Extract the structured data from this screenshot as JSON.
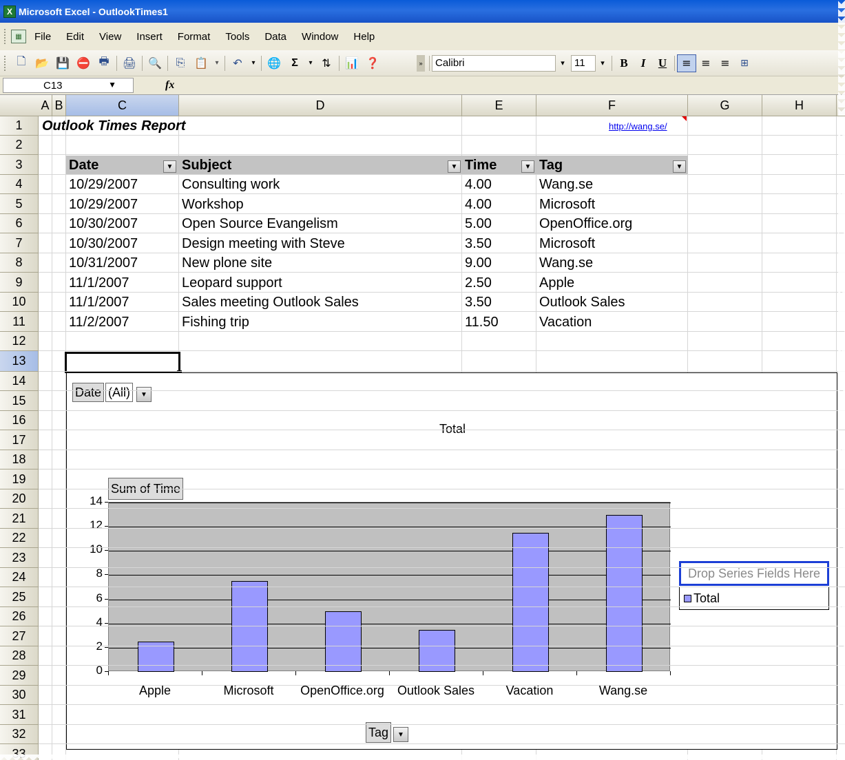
{
  "window": {
    "title": "Microsoft Excel - OutlookTimes1",
    "app_icon": "excel-icon"
  },
  "menu": [
    "File",
    "Edit",
    "View",
    "Insert",
    "Format",
    "Tools",
    "Data",
    "Window",
    "Help"
  ],
  "toolbar": {
    "font_name": "Calibri",
    "font_size": "11",
    "bold_label": "B",
    "italic_label": "I",
    "underline_label": "U",
    "sigma_label": "Σ"
  },
  "formula_bar": {
    "cell_ref": "C13",
    "fx_label": "fx",
    "content": ""
  },
  "columns": [
    "A",
    "B",
    "C",
    "D",
    "E",
    "F",
    "G",
    "H"
  ],
  "rows": [
    "1",
    "2",
    "3",
    "4",
    "5",
    "6",
    "7",
    "8",
    "9",
    "10",
    "11",
    "12",
    "13",
    "14",
    "15",
    "16",
    "17",
    "18",
    "19",
    "20",
    "21",
    "22",
    "23",
    "24",
    "25",
    "26",
    "27",
    "28",
    "29",
    "30",
    "31",
    "32",
    "33"
  ],
  "sheet": {
    "title": "Outlook Times Report",
    "link": "http://wang.se/",
    "headers": [
      "Date",
      "Subject",
      "Time",
      "Tag"
    ],
    "records": [
      {
        "date": "10/29/2007",
        "subject": "Consulting work",
        "time": "4.00",
        "tag": "Wang.se"
      },
      {
        "date": "10/29/2007",
        "subject": "Workshop",
        "time": "4.00",
        "tag": "Microsoft"
      },
      {
        "date": "10/30/2007",
        "subject": "Open Source Evangelism",
        "time": "5.00",
        "tag": "OpenOffice.org"
      },
      {
        "date": "10/30/2007",
        "subject": "Design meeting with Steve",
        "time": "3.50",
        "tag": "Microsoft"
      },
      {
        "date": "10/31/2007",
        "subject": "New plone site",
        "time": "9.00",
        "tag": "Wang.se"
      },
      {
        "date": "11/1/2007",
        "subject": "Leopard support",
        "time": "2.50",
        "tag": "Apple"
      },
      {
        "date": "11/1/2007",
        "subject": "Sales meeting Outlook Sales",
        "time": "3.50",
        "tag": "Outlook Sales"
      },
      {
        "date": "11/2/2007",
        "subject": "Fishing trip",
        "time": "11.50",
        "tag": "Vacation"
      }
    ]
  },
  "pivot": {
    "page_field": "Date",
    "page_value": "(All)",
    "data_field": "Sum of Time",
    "category_field": "Tag",
    "drop_series": "Drop Series Fields Here"
  },
  "chart_data": {
    "type": "bar",
    "title": "Total",
    "categories": [
      "Apple",
      "Microsoft",
      "OpenOffice.org",
      "Outlook Sales",
      "Vacation",
      "Wang.se"
    ],
    "series": [
      {
        "name": "Total",
        "values": [
          2.5,
          7.5,
          5,
          3.5,
          11.5,
          13
        ]
      }
    ],
    "yticks": [
      "0",
      "2",
      "4",
      "6",
      "8",
      "10",
      "12",
      "14"
    ],
    "ylim": [
      0,
      14
    ],
    "grid": true,
    "legend": "right",
    "bar_color": "#9999ff",
    "plot_background": "#c0c0c0"
  }
}
